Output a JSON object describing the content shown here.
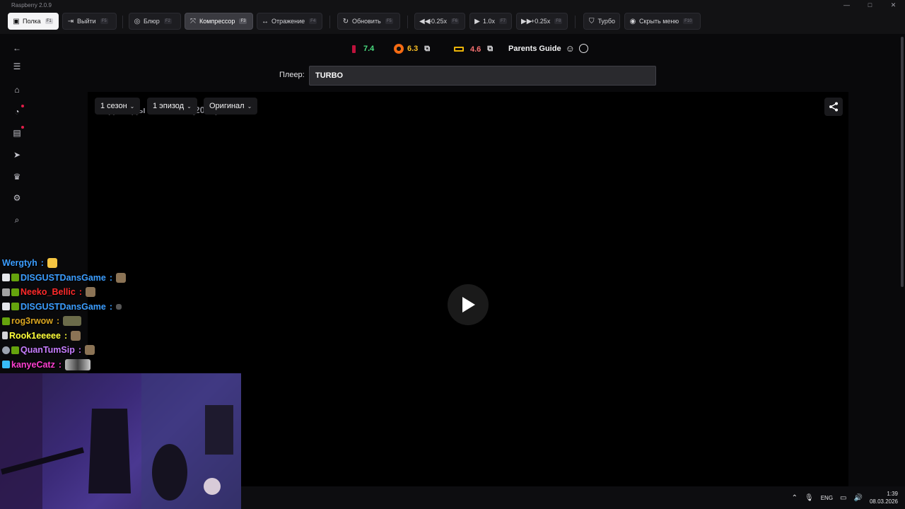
{
  "window": {
    "title": "Raspberry 2.0.9",
    "controls": [
      "—",
      "□",
      "✕"
    ]
  },
  "toolbar": {
    "shelf": {
      "label": "Полка",
      "key": "F1"
    },
    "exit": {
      "label": "Выйти",
      "key": "F5"
    },
    "blur": {
      "label": "Блюр",
      "key": "F2"
    },
    "compressor": {
      "label": "Компрессор",
      "key": "F3"
    },
    "mirror": {
      "label": "Отражение",
      "key": "F4"
    },
    "refresh": {
      "label": "Обновить",
      "key": "F5"
    },
    "slower": {
      "label": "-0.25x",
      "key": "F6"
    },
    "speed": {
      "label": "1.0x",
      "key": "F7"
    },
    "faster": {
      "label": "+0.25x",
      "key": "F8"
    },
    "turbo": {
      "label": "Турбо"
    },
    "hide_menu": {
      "label": "Скрыть меню",
      "key": "F10"
    }
  },
  "ratings": {
    "rating1": {
      "value": "7.4",
      "color": "#22c55e"
    },
    "rating2": {
      "value": "6.3",
      "color": "#f59e0b"
    },
    "rating3": {
      "value": "4.6",
      "color": "#ef4444"
    },
    "parents_guide": "Parents Guide"
  },
  "player": {
    "label": "Плеер:",
    "value": "TURBO"
  },
  "video": {
    "title": "Однажды в России (2014)",
    "season": "1 сезон",
    "episode": "1 эпизод",
    "audio": "Оригинал"
  },
  "chat": [
    {
      "user": "Wergtyh",
      "color": "#3b82f6",
      "sep": ":"
    },
    {
      "user": "DISGUSTDansGame",
      "color": "#3b82f6",
      "sep": ":"
    },
    {
      "user": "Neeko_Bellic",
      "color": "#ef1e1e",
      "sep": ":"
    },
    {
      "user": "DISGUSTDansGame",
      "color": "#3b82f6",
      "sep": ":"
    },
    {
      "user": "rog3rwow",
      "color": "#daa520",
      "sep": ":"
    },
    {
      "user": "Rook1eeeee",
      "color": "#ffff33",
      "sep": ":"
    },
    {
      "user": "QuanTumSip",
      "color": "#c77dff",
      "sep": ":"
    },
    {
      "user": "kanyeCatz",
      "color": "#ff3fd1",
      "sep": ":"
    }
  ],
  "taskbar": {
    "lang": "ENG",
    "time": "1:39",
    "date": "08.03.2026"
  }
}
